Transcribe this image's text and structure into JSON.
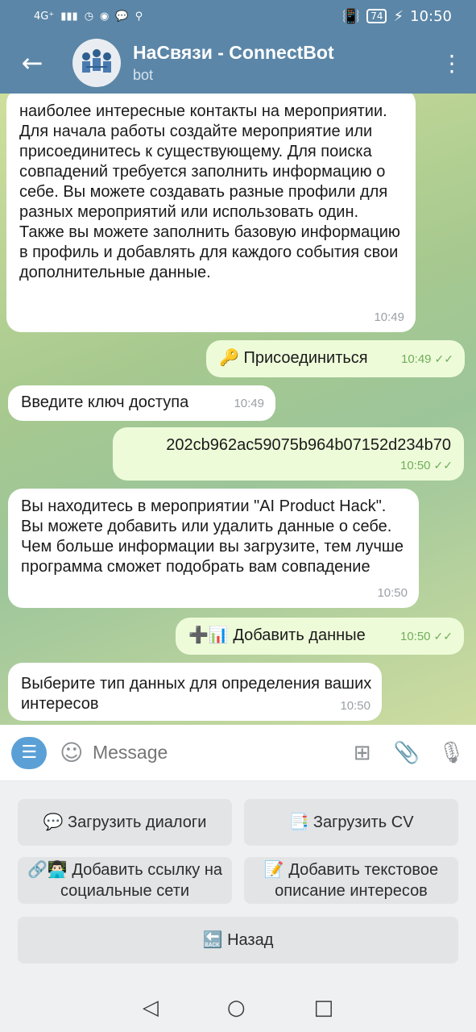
{
  "status": {
    "network": "4G⁺",
    "time": "10:50",
    "battery": "74"
  },
  "header": {
    "title": "НаСвязи - ConnectBot",
    "subtitle": "bot"
  },
  "messages": [
    {
      "dir": "in",
      "text": "наиболее интересные контакты на мероприятии. Для начала работы создайте мероприятие или присоединитесь к существующему. Для поиска совпадений требуется заполнить информацию о себе. Вы можете создавать разные профили для разных мероприятий или использовать один. Также вы можете заполнить базовую информацию в профиль и добавлять для каждого события свои дополнительные данные.",
      "time": "10:49"
    },
    {
      "dir": "out",
      "text": "🔑 Присоединиться",
      "time": "10:49"
    },
    {
      "dir": "in",
      "text": "Введите ключ доступа",
      "time": "10:49"
    },
    {
      "dir": "out",
      "text": "202cb962ac59075b964b07152d234b70",
      "time": "10:50"
    },
    {
      "dir": "in",
      "text": "Вы находитесь в мероприятии \"AI Product Hack\". Вы можете добавить или удалить данные о себе. Чем больше информации вы загрузите, тем лучше программа сможет подобрать вам совпадение",
      "time": "10:50"
    },
    {
      "dir": "out",
      "text": "➕📊 Добавить данные",
      "time": "10:50"
    },
    {
      "dir": "in",
      "text": "Выберите тип данных для определения ваших интересов",
      "time": "10:50"
    }
  ],
  "input": {
    "placeholder": "Message"
  },
  "keyboard": {
    "upload_dialogs": "💬 Загрузить диалоги",
    "upload_cv": "📑 Загрузить CV",
    "add_social": "🔗👨🏻‍💻 Добавить ссылку на социальные сети",
    "add_text": "📝 Добавить текстовое описание интересов",
    "back": "🔙 Назад"
  },
  "colors": {
    "header": "#5b86a7",
    "incoming_bubble": "#ffffff",
    "outgoing_bubble": "#eefbd9",
    "accent": "#5aa0d6"
  }
}
